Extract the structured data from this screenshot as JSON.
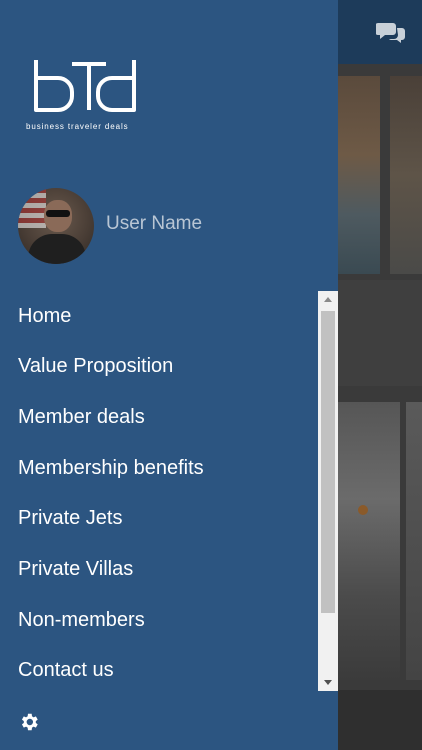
{
  "brand": {
    "logo_text": "bTd",
    "tagline": "business traveler deals"
  },
  "user": {
    "name": "User Name"
  },
  "menu": {
    "items": [
      {
        "label": "Home"
      },
      {
        "label": "Value Proposition"
      },
      {
        "label": "Member deals"
      },
      {
        "label": "Membership benefits"
      },
      {
        "label": "Private Jets"
      },
      {
        "label": "Private Villas"
      },
      {
        "label": "Non-members"
      },
      {
        "label": "Contact us"
      }
    ]
  },
  "icons": {
    "settings": "gear-icon",
    "chat": "chat-bubbles-icon"
  },
  "colors": {
    "drawer_bg": "#2c5581",
    "topbar_bg": "#1d3b5a",
    "menu_text": "#ffffff",
    "username_text": "#b9c6d4"
  }
}
